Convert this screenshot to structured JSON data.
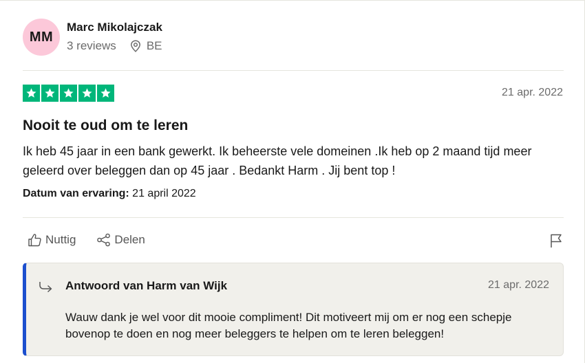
{
  "reviewer": {
    "initials": "MM",
    "name": "Marc Mikolajczak",
    "reviews": "3 reviews",
    "country": "BE"
  },
  "review": {
    "rating": 5,
    "date": "21 apr. 2022",
    "title": "Nooit te oud om te leren",
    "body": "Ik heb 45 jaar in een bank gewerkt. Ik beheerste vele domeinen .Ik heb op 2 maand tijd meer geleerd over beleggen dan op 45 jaar . Bedankt Harm . Jij bent top !",
    "experience_label": "Datum van ervaring:",
    "experience_date": "21 april 2022"
  },
  "actions": {
    "useful_label": "Nuttig",
    "share_label": "Delen"
  },
  "reply": {
    "author": "Antwoord van Harm van Wijk",
    "date": "21 apr. 2022",
    "text": "Wauw dank je wel voor dit mooie compliment! Dit motiveert mij om er nog een schepje bovenop te doen en nog meer beleggers te helpen om te leren beleggen!"
  },
  "colors": {
    "star_green": "#00b67a",
    "avatar_pink": "#fcc8d9",
    "reply_accent": "#1c4fce"
  },
  "icons": [
    "location-pin-icon",
    "star-icon",
    "thumbs-up-icon",
    "share-icon",
    "flag-icon",
    "reply-arrow-icon"
  ]
}
